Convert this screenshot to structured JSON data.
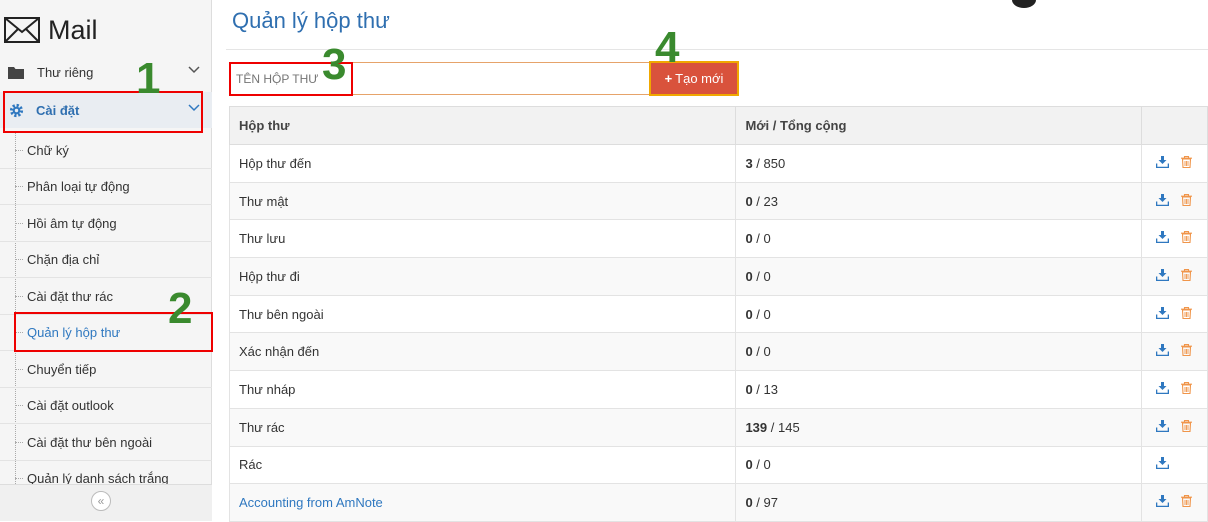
{
  "app": {
    "logo_text": "Mail"
  },
  "sidebar": {
    "top_items": [
      {
        "label": "Thư riêng"
      },
      {
        "label": "Cài đặt"
      }
    ],
    "settings_items": [
      {
        "label": "Chữ ký"
      },
      {
        "label": "Phân loại tự động"
      },
      {
        "label": "Hồi âm tự động"
      },
      {
        "label": "Chặn địa chỉ"
      },
      {
        "label": "Cài đặt thư rác"
      },
      {
        "label": "Quản lý hộp thư"
      },
      {
        "label": "Chuyển tiếp"
      },
      {
        "label": "Cài đặt outlook"
      },
      {
        "label": "Cài đặt thư bên ngoài"
      },
      {
        "label": "Quản lý danh sách trắng"
      }
    ],
    "collapse_glyph": "«"
  },
  "main": {
    "title": "Quản lý hộp thư",
    "input_placeholder": "TÊN HỘP THƯ",
    "create_button": {
      "plus": "+",
      "label": "Tạo mới"
    },
    "table": {
      "headers": [
        "Hộp thư",
        "Mới / Tổng cộng",
        ""
      ],
      "rows": [
        {
          "name": "Hộp thư đến",
          "new": "3",
          "sep": " / ",
          "total": "850",
          "delete": true
        },
        {
          "name": "Thư mật",
          "new": "0",
          "sep": " / ",
          "total": "23",
          "delete": true
        },
        {
          "name": "Thư lưu",
          "new": "0",
          "sep": " / ",
          "total": "0",
          "delete": true
        },
        {
          "name": "Hộp thư đi",
          "new": "0",
          "sep": " / ",
          "total": "0",
          "delete": true
        },
        {
          "name": "Thư bên ngoài",
          "new": "0",
          "sep": " / ",
          "total": "0",
          "delete": true
        },
        {
          "name": "Xác nhận đến",
          "new": "0",
          "sep": " / ",
          "total": "0",
          "delete": true
        },
        {
          "name": "Thư nháp",
          "new": "0",
          "sep": " / ",
          "total": "13",
          "delete": true
        },
        {
          "name": "Thư rác",
          "new": "139",
          "sep": " / ",
          "total": "145",
          "delete": true
        },
        {
          "name": "Rác",
          "new": "0",
          "sep": " / ",
          "total": "0",
          "delete": false
        },
        {
          "name": "Accounting from AmNote",
          "new": "0",
          "sep": " / ",
          "total": "97",
          "delete": true,
          "link": true
        }
      ]
    }
  },
  "annotations": [
    "1",
    "2",
    "3",
    "4"
  ],
  "colors": {
    "accent_blue": "#2f6fb0",
    "create_button": "#d9523c",
    "highlight_red": "#e00000",
    "annotation_green": "#3a8a2e",
    "active_bg": "#e9edf2"
  }
}
